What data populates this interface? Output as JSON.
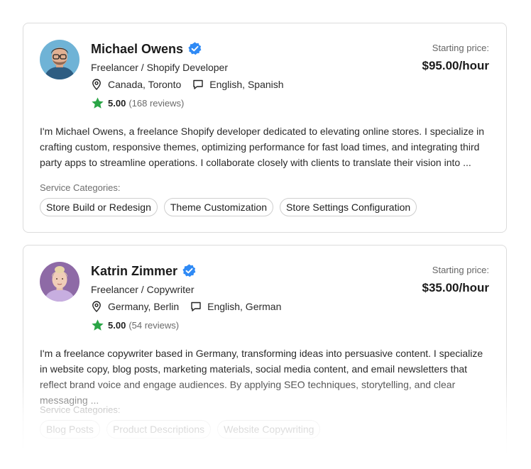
{
  "colors": {
    "accent_blue": "#2f8af5",
    "star_green": "#2aa546",
    "border": "#dcdcdc"
  },
  "freelancers": [
    {
      "name": "Michael Owens",
      "role": "Freelancer / Shopify Developer",
      "location": "Canada, Toronto",
      "languages": "English, Spanish",
      "rating": "5.00",
      "reviews": "(168 reviews)",
      "price_label": "Starting price:",
      "price": "$95.00/hour",
      "description": "I'm Michael Owens, a freelance Shopify developer dedicated to elevating online stores. I specialize in crafting custom, responsive themes, optimizing performance for fast load times, and integrating third party apps to streamline operations. I collaborate closely with clients to translate their vision into ...",
      "categories_label": "Service Categories:",
      "categories": [
        "Store Build or Redesign",
        "Theme Customization",
        "Store Settings Configuration"
      ],
      "icons": {
        "verified": "verified-badge-icon",
        "location": "map-pin-icon",
        "language": "chat-bubble-icon",
        "rating": "star-icon"
      }
    },
    {
      "name": "Katrin Zimmer",
      "role": "Freelancer / Copywriter",
      "location": "Germany, Berlin",
      "languages": "English, German",
      "rating": "5.00",
      "reviews": "(54 reviews)",
      "price_label": "Starting price:",
      "price": "$35.00/hour",
      "description": "I'm a freelance copywriter based in Germany, transforming ideas into persuasive content. I specialize in website copy, blog posts, marketing materials, social media content, and email newsletters that reflect brand voice and engage audiences. By applying SEO techniques, storytelling, and clear messaging ...",
      "categories_label": "Service Categories:",
      "categories": [
        "Blog Posts",
        "Product Descriptions",
        "Website Copywriting"
      ],
      "icons": {
        "verified": "verified-badge-icon",
        "location": "map-pin-icon",
        "language": "chat-bubble-icon",
        "rating": "star-icon"
      }
    }
  ]
}
